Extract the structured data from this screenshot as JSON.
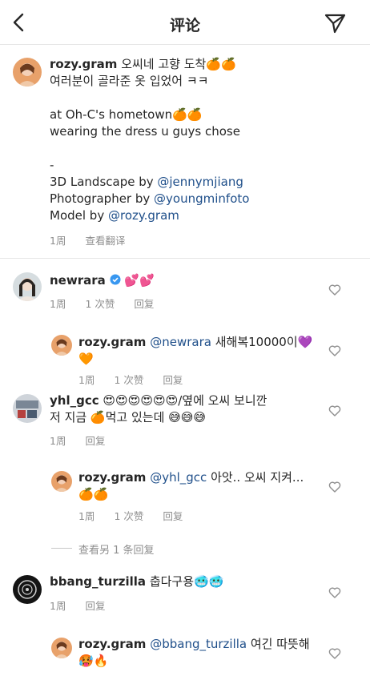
{
  "header": {
    "title": "评论"
  },
  "caption": {
    "username": "rozy.gram",
    "line1": "오씨네 고향 도착🍊🍊",
    "line2": "여러분이 골라준 옷 입었어 ㅋㅋ",
    "line3": "at Oh-C's hometown🍊🍊",
    "line4": "wearing the dress u guys chose",
    "line5": "-",
    "credit1_prefix": "3D Landscape by ",
    "credit1_mention": "@jennymjiang",
    "credit2_prefix": "Photographer by ",
    "credit2_mention": "@youngminfoto",
    "credit3_prefix": "Model by ",
    "credit3_mention": "@rozy.gram",
    "time": "1周",
    "translate": "查看翻译"
  },
  "comments": [
    {
      "username": "newrara",
      "text": "💕💕",
      "time": "1周",
      "likes": "1 次赞",
      "reply": "回复"
    },
    {
      "username": "rozy.gram",
      "mention": "@newrara",
      "text": "새해복10000이💜🧡",
      "time": "1周",
      "likes": "1 次赞",
      "reply": "回复"
    },
    {
      "username": "yhl_gcc",
      "text_line1": "😍😍😍😍😍😍/옆에 오씨 보니깐",
      "text_line2": "저 지금 🍊먹고 있는데 😅😅😅",
      "time": "1周",
      "reply": "回复"
    },
    {
      "username": "rozy.gram",
      "mention": "@yhl_gcc",
      "text_line1": "아앗.. 오씨 지켜...",
      "text_line2": "🍊🍊",
      "time": "1周",
      "likes": "1 次赞",
      "reply": "回复"
    },
    {
      "username": "bbang_turzilla",
      "text": "춥다구용🥶🥶",
      "time": "1周",
      "reply": "回复"
    },
    {
      "username": "rozy.gram",
      "mention": "@bbang_turzilla",
      "text_line1": "여긴 따뜻해",
      "text_line2": "🥵🔥"
    }
  ],
  "view_more": "查看另 1 条回复",
  "colors": {
    "mention": "#1f4f8a",
    "meta": "#8e8e8e",
    "verified": "#3897f0"
  }
}
